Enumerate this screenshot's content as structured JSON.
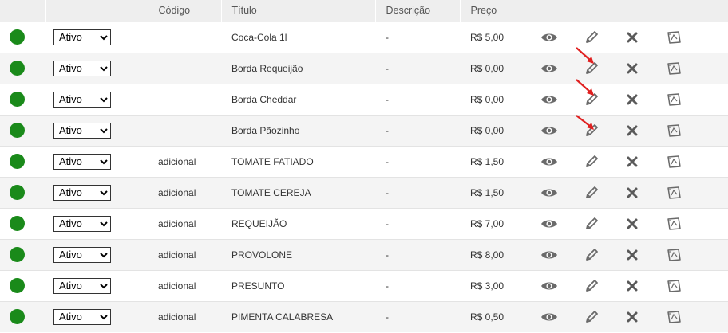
{
  "header": {
    "codigo": "Código",
    "titulo": "Título",
    "descricao": "Descrição",
    "preco": "Preço"
  },
  "status_option": "Ativo",
  "status_color": "#1a8a1a",
  "annotation_color": "#e02020",
  "rows": [
    {
      "codigo": "",
      "titulo": "Coca-Cola 1l",
      "descricao": "-",
      "preco": "R$ 5,00"
    },
    {
      "codigo": "",
      "titulo": "Borda Requeijão",
      "descricao": "-",
      "preco": "R$ 0,00"
    },
    {
      "codigo": "",
      "titulo": "Borda Cheddar",
      "descricao": "-",
      "preco": "R$ 0,00"
    },
    {
      "codigo": "",
      "titulo": "Borda Pãozinho",
      "descricao": "-",
      "preco": "R$ 0,00"
    },
    {
      "codigo": "adicional",
      "titulo": "TOMATE FATIADO",
      "descricao": "-",
      "preco": "R$ 1,50"
    },
    {
      "codigo": "adicional",
      "titulo": "TOMATE CEREJA",
      "descricao": "-",
      "preco": "R$ 1,50"
    },
    {
      "codigo": "adicional",
      "titulo": "REQUEIJÃO",
      "descricao": "-",
      "preco": "R$ 7,00"
    },
    {
      "codigo": "adicional",
      "titulo": "PROVOLONE",
      "descricao": "-",
      "preco": "R$ 8,00"
    },
    {
      "codigo": "adicional",
      "titulo": "PRESUNTO",
      "descricao": "-",
      "preco": "R$ 3,00"
    },
    {
      "codigo": "adicional",
      "titulo": "PIMENTA CALABRESA",
      "descricao": "-",
      "preco": "R$ 0,50"
    }
  ],
  "row_icons": [
    "eye-icon",
    "pencil-icon",
    "close-icon",
    "image-icon"
  ]
}
